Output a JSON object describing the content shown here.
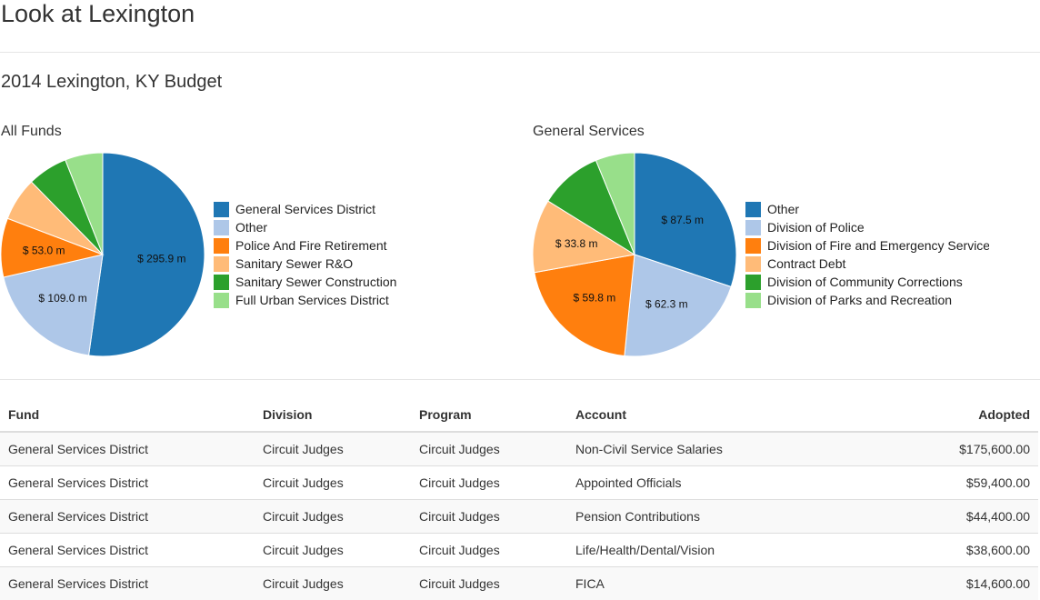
{
  "site_title": "Look at Lexington",
  "budget_title": "2014 Lexington, KY Budget",
  "colors": [
    "#1f77b4",
    "#aec7e8",
    "#ff7f0e",
    "#ffbb78",
    "#2ca02c",
    "#98df8a"
  ],
  "chart_data": [
    {
      "type": "pie",
      "title": "All Funds",
      "legend_placement": "right",
      "series": [
        {
          "name": "General Services District",
          "value": 295.9,
          "label": "$ 295.9 m"
        },
        {
          "name": "Other",
          "value": 109.0,
          "label": "$ 109.0 m"
        },
        {
          "name": "Police And Fire Retirement",
          "value": 53.0,
          "label": "$ 53.0 m"
        },
        {
          "name": "Sanitary Sewer R&O",
          "value": 39.0,
          "label": ""
        },
        {
          "name": "Sanitary Sewer Construction",
          "value": 36.0,
          "label": ""
        },
        {
          "name": "Full Urban Services District",
          "value": 34.0,
          "label": ""
        }
      ]
    },
    {
      "type": "pie",
      "title": "General Services",
      "legend_placement": "right",
      "series": [
        {
          "name": "Other",
          "value": 87.5,
          "label": "$ 87.5 m"
        },
        {
          "name": "Division of Police",
          "value": 62.3,
          "label": "$ 62.3 m"
        },
        {
          "name": "Division of Fire and Emergency Services",
          "value": 59.8,
          "label": "$ 59.8 m"
        },
        {
          "name": "Contract Debt",
          "value": 33.8,
          "label": "$ 33.8 m"
        },
        {
          "name": "Division of Community Corrections",
          "value": 29.0,
          "label": ""
        },
        {
          "name": "Division of Parks and Recreation",
          "value": 18.0,
          "label": ""
        }
      ]
    }
  ],
  "table": {
    "columns": [
      "Fund",
      "Division",
      "Program",
      "Account",
      "Adopted"
    ],
    "rows": [
      [
        "General Services District",
        "Circuit Judges",
        "Circuit Judges",
        "Non-Civil Service Salaries",
        "$175,600.00"
      ],
      [
        "General Services District",
        "Circuit Judges",
        "Circuit Judges",
        "Appointed Officials",
        "$59,400.00"
      ],
      [
        "General Services District",
        "Circuit Judges",
        "Circuit Judges",
        "Pension Contributions",
        "$44,400.00"
      ],
      [
        "General Services District",
        "Circuit Judges",
        "Circuit Judges",
        "Life/Health/Dental/Vision",
        "$38,600.00"
      ],
      [
        "General Services District",
        "Circuit Judges",
        "Circuit Judges",
        "FICA",
        "$14,600.00"
      ]
    ]
  }
}
